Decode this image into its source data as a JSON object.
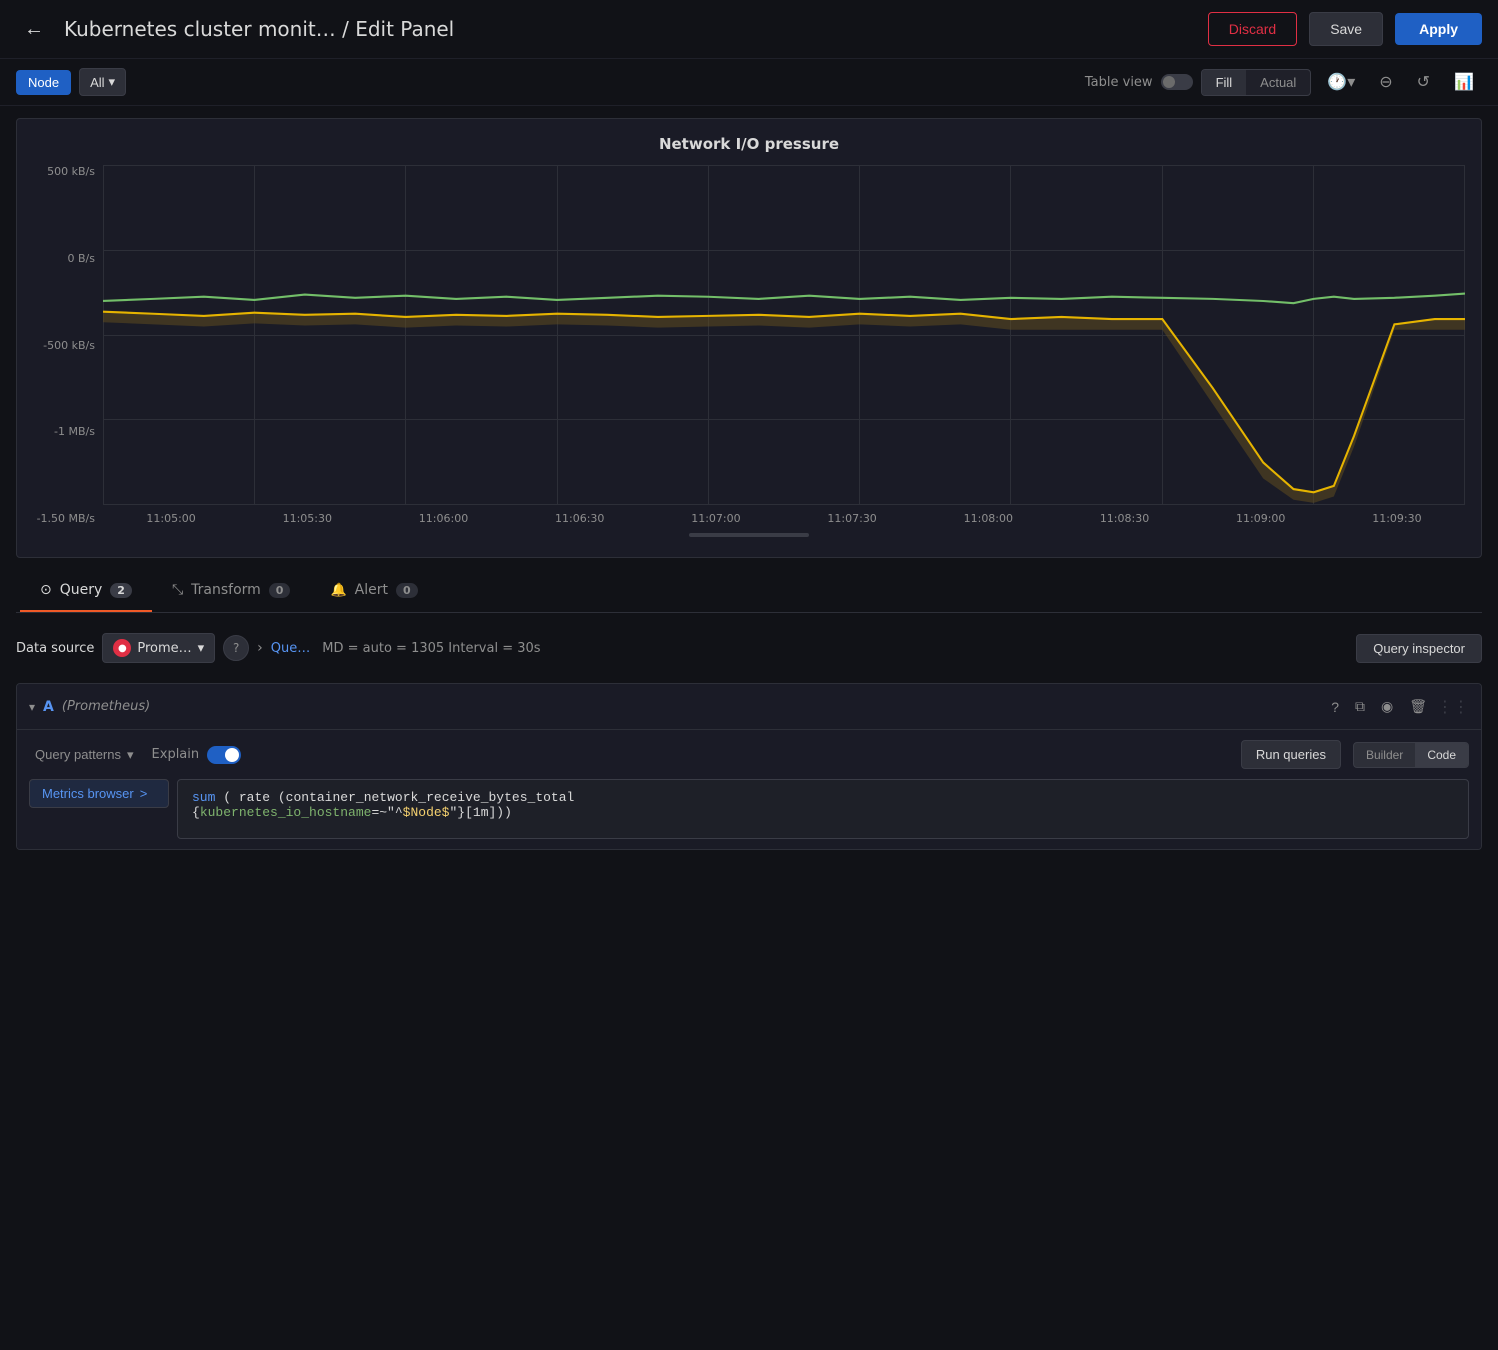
{
  "header": {
    "back_label": "←",
    "title": "Kubernetes cluster monit… / Edit Panel",
    "discard_label": "Discard",
    "save_label": "Save",
    "apply_label": "Apply"
  },
  "toolbar": {
    "node_label": "Node",
    "all_label": "All",
    "all_chevron": "▾",
    "table_view_label": "Table view",
    "fill_label": "Fill",
    "actual_label": "Actual",
    "zoom_out_icon": "⊖",
    "refresh_icon": "↺"
  },
  "chart": {
    "title": "Network I/O pressure",
    "y_labels": [
      "500 kB/s",
      "0 B/s",
      "-500 kB/s",
      "-1 MB/s",
      "-1.50 MB/s"
    ],
    "x_labels": [
      "11:05:00",
      "11:05:30",
      "11:06:00",
      "11:06:30",
      "11:07:00",
      "11:07:30",
      "11:08:00",
      "11:08:30",
      "11:09:00",
      "11:09:30"
    ]
  },
  "tabs": [
    {
      "id": "query",
      "icon": "⊙",
      "label": "Query",
      "badge": "2",
      "active": true
    },
    {
      "id": "transform",
      "icon": "⤡",
      "label": "Transform",
      "badge": "0",
      "active": false
    },
    {
      "id": "alert",
      "icon": "🔔",
      "label": "Alert",
      "badge": "0",
      "active": false
    }
  ],
  "query_panel": {
    "datasource_label": "Data source",
    "datasource_name": "Prome…",
    "help_icon": "?",
    "expand_icon": "›",
    "query_link": "Que…",
    "query_meta": "MD = auto = 1305   Interval = 30s",
    "query_inspector_label": "Query inspector"
  },
  "query_item": {
    "letter": "A",
    "ds_name": "(Prometheus)",
    "help_icon": "?",
    "copy_icon": "⧉",
    "eye_icon": "◉",
    "delete_icon": "🗑",
    "drag_icon": "⋮⋮",
    "query_patterns_label": "Query patterns",
    "chevron": "▾",
    "explain_label": "Explain",
    "run_queries_label": "Run queries",
    "builder_label": "Builder",
    "code_label": "Code"
  },
  "metrics_browser": {
    "label": "Metrics browser",
    "chevron": ">",
    "query_text_line1": "sum (rate (container_network_receive_bytes_total",
    "query_text_line2": "{kubernetes_io_hostname=~\"^$Node$\"}[1m]))"
  }
}
